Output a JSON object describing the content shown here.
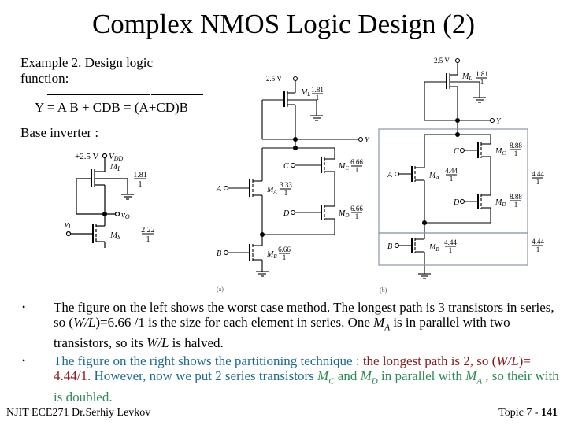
{
  "slide": {
    "title": "Complex NMOS Logic Design (2)",
    "example_line1": "Example 2. Design logic",
    "example_line2": "function:",
    "equation": "Y = A B + CDB = (A+CD)B",
    "base_inverter_label": "Base inverter :"
  },
  "base_inverter": {
    "supply": "+2.5 V",
    "vdd": "VDD",
    "load": "ML",
    "load_ratio": {
      "num": "1.81",
      "den": "1"
    },
    "output": "vO",
    "input": "vI",
    "switch": "MS",
    "switch_ratio": {
      "num": "2.22",
      "den": "1"
    }
  },
  "figure_a": {
    "label": "(a)",
    "supply": "2.5 V",
    "output": "Y",
    "load": {
      "name": "ML",
      "num": "1.81",
      "den": "1"
    },
    "transistors": [
      {
        "gate": "A",
        "name": "MA",
        "num": "3.33",
        "den": "1"
      },
      {
        "gate": "C",
        "name": "MC",
        "num": "6.66",
        "den": "1"
      },
      {
        "gate": "D",
        "name": "MD",
        "num": "6.66",
        "den": "1"
      },
      {
        "gate": "B",
        "name": "MB",
        "num": "6.66",
        "den": "1"
      }
    ]
  },
  "figure_b": {
    "label": "(b)",
    "supply": "2.5 V",
    "output": "Y",
    "load": {
      "name": "ML",
      "num": "1.81",
      "den": "1"
    },
    "transistors": [
      {
        "gate": "A",
        "name": "MA",
        "num": "4.44",
        "den": "1"
      },
      {
        "gate": "C",
        "name": "MC",
        "num": "8.88",
        "den": "1"
      },
      {
        "gate": "D",
        "name": "MD",
        "num": "8.88",
        "den": "1"
      },
      {
        "gate": "B",
        "name": "MB",
        "num": "4.44",
        "den": "1"
      }
    ],
    "partition_ratios": [
      {
        "num": "4.44",
        "den": "1"
      },
      {
        "num": "4.44",
        "den": "1"
      }
    ]
  },
  "bullets": [
    {
      "parts": [
        {
          "t": "The figure on the left shows the worst case method. The longest path is 3 transistors in series, so (",
          "c": ""
        },
        {
          "t": "W/L",
          "c": "mi"
        },
        {
          "t": ")=6.66 /1 is the size for each element in series.  One  ",
          "c": ""
        },
        {
          "t": "MA",
          "c": "mi"
        },
        {
          "t": "  is in parallel with two transistors, so its ",
          "c": ""
        },
        {
          "t": "W/L",
          "c": "mi"
        },
        {
          "t": " is halved.",
          "c": ""
        }
      ]
    },
    {
      "parts": [
        {
          "t": "The figure on the right shows the partitioning technique : ",
          "c": "blue"
        },
        {
          "t": "the longest path is 2, so (",
          "c": "red"
        },
        {
          "t": "W/L",
          "c": "red mi"
        },
        {
          "t": ")= 4.44/1",
          "c": "red"
        },
        {
          "t": ". However, now we put 2 series transistors ",
          "c": "blue"
        },
        {
          "t": "MC",
          "c": "green mi"
        },
        {
          "t": "  and  ",
          "c": "green"
        },
        {
          "t": "MD",
          "c": "green mi"
        },
        {
          "t": "  in parallel with ",
          "c": "green"
        },
        {
          "t": "MA",
          "c": "green mi"
        },
        {
          "t": " , so their with is doubled.",
          "c": "green"
        }
      ]
    }
  ],
  "footer": {
    "left": "NJIT  ECE271   Dr.Serhiy Levkov",
    "right_prefix": "Topic 7 - ",
    "page": "141"
  },
  "colors": {
    "blue": "#1E6A96",
    "red": "#8B1A1A",
    "green": "#2E8B57"
  }
}
